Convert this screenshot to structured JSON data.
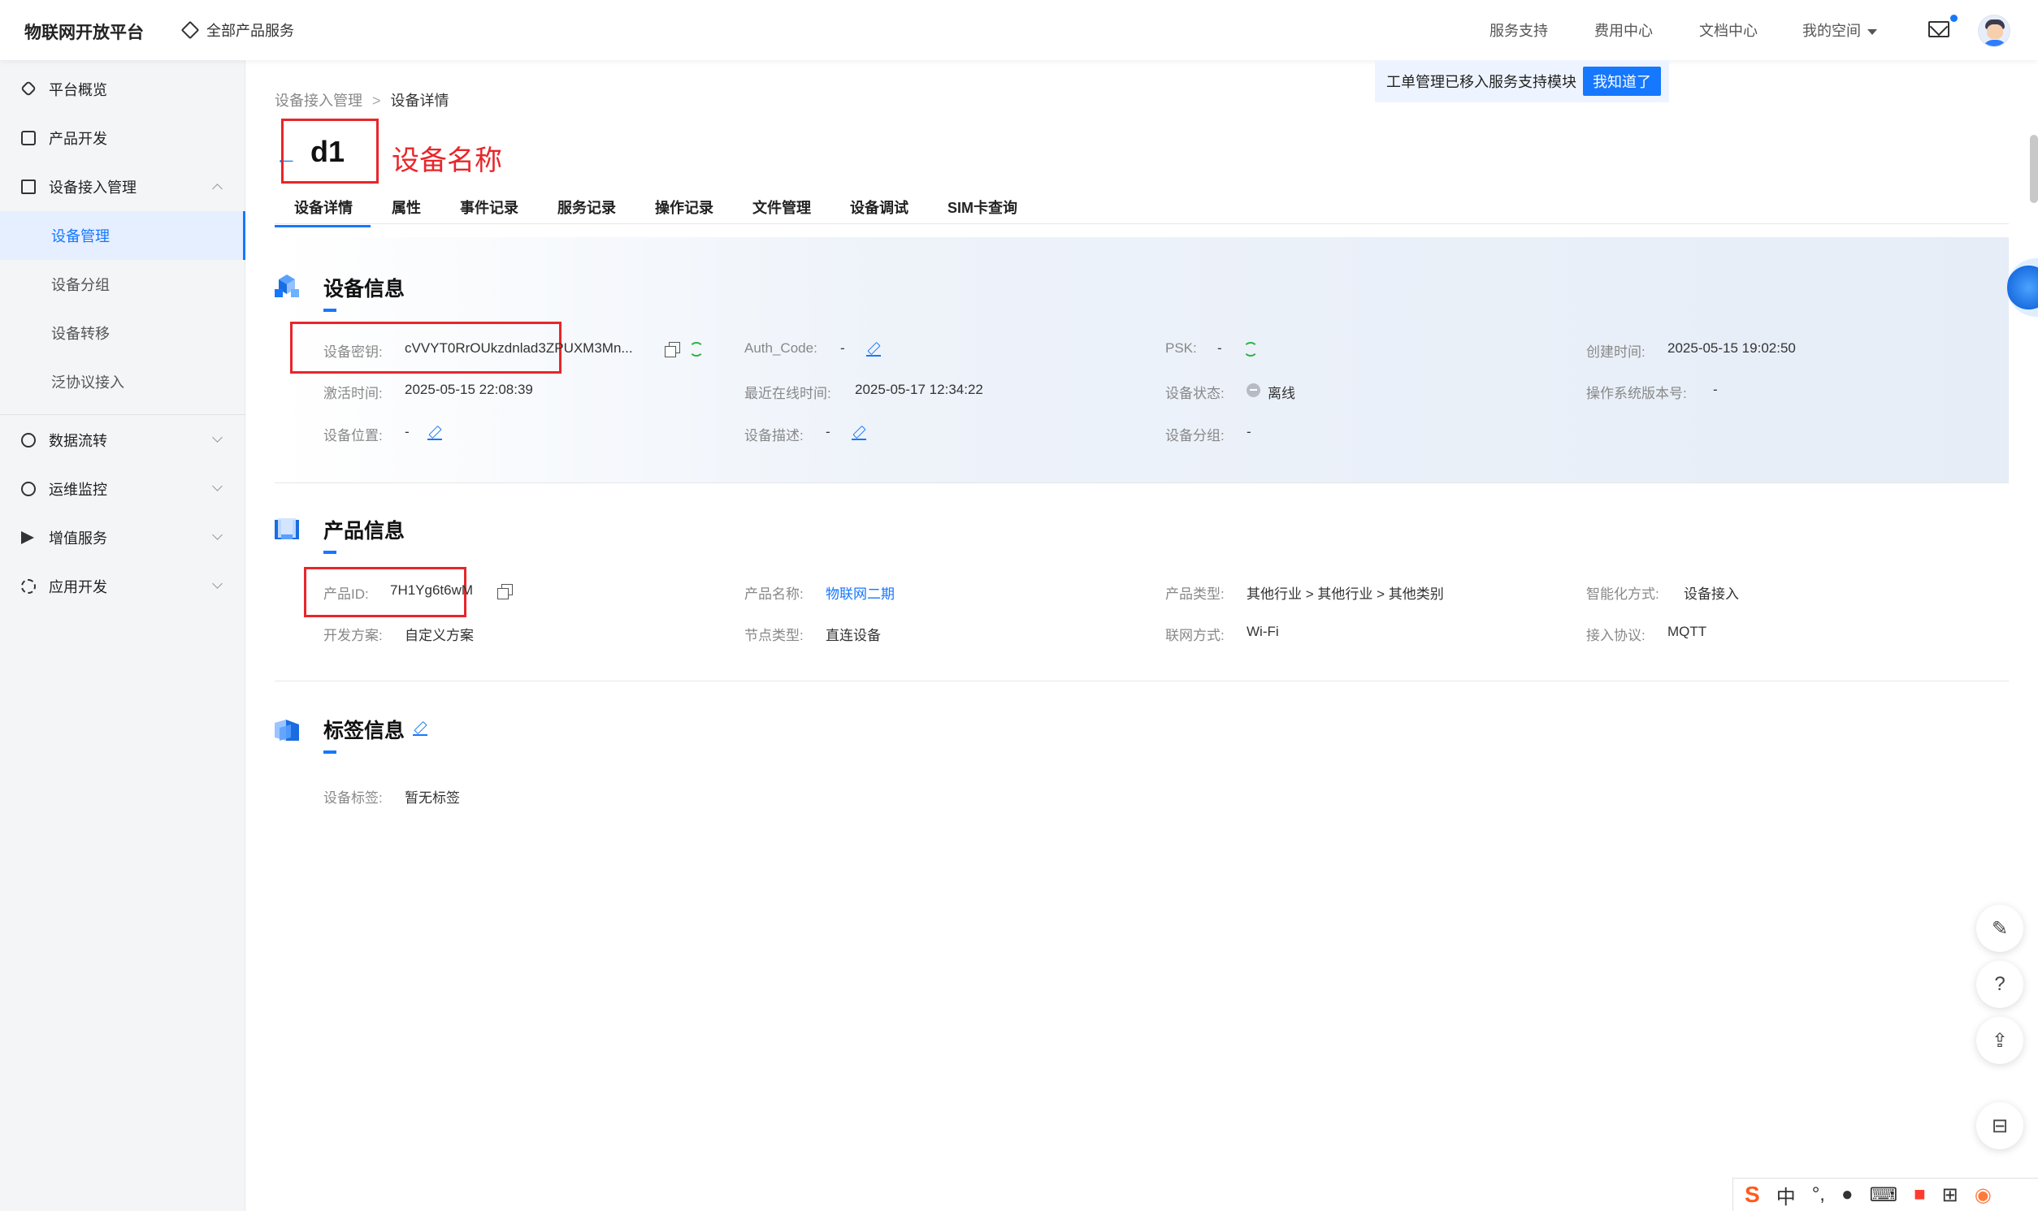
{
  "topbar": {
    "brand": "物联网开放平台",
    "all_products": "全部产品服务",
    "nav": [
      "服务支持",
      "费用中心",
      "文档中心",
      "我的空间"
    ]
  },
  "notice": {
    "text": "工单管理已移入服务支持模块",
    "button": "我知道了"
  },
  "sidebar": {
    "items": [
      {
        "label": "平台概览",
        "icon": "hexagon-icon"
      },
      {
        "label": "产品开发",
        "icon": "cube-icon"
      },
      {
        "label": "设备接入管理",
        "icon": "layers-icon",
        "expanded": true
      }
    ],
    "subitems": [
      "设备管理",
      "设备分组",
      "设备转移",
      "泛协议接入"
    ],
    "active_sub": "设备管理",
    "items2": [
      {
        "label": "数据流转",
        "icon": "flow-icon"
      },
      {
        "label": "运维监控",
        "icon": "monitor-icon"
      },
      {
        "label": "增值服务",
        "icon": "send-icon"
      },
      {
        "label": "应用开发",
        "icon": "dev-icon"
      }
    ]
  },
  "breadcrumb": {
    "parent": "设备接入管理",
    "separator": ">",
    "current": "设备详情"
  },
  "device": {
    "name": "d1",
    "annotation": "设备名称"
  },
  "tabs": [
    "设备详情",
    "属性",
    "事件记录",
    "服务记录",
    "操作记录",
    "文件管理",
    "设备调试",
    "SIM卡查询"
  ],
  "device_info": {
    "title": "设备信息",
    "fields": {
      "secret_label": "设备密钥:",
      "secret_value": "cVVYT0RrOUkzdnlad3ZPUXM3Mn...",
      "auth_label": "Auth_Code:",
      "auth_value": "-",
      "psk_label": "PSK:",
      "psk_value": "-",
      "created_label": "创建时间:",
      "created_value": "2025-05-15 19:02:50",
      "activated_label": "激活时间:",
      "activated_value": "2025-05-15 22:08:39",
      "last_online_label": "最近在线时间:",
      "last_online_value": "2025-05-17 12:34:22",
      "status_label": "设备状态:",
      "status_value": "离线",
      "os_label": "操作系统版本号:",
      "os_value": "-",
      "location_label": "设备位置:",
      "location_value": "-",
      "desc_label": "设备描述:",
      "desc_value": "-",
      "group_label": "设备分组:",
      "group_value": "-"
    }
  },
  "product_info": {
    "title": "产品信息",
    "fields": {
      "id_label": "产品ID:",
      "id_value": "7H1Yg6t6wM",
      "name_label": "产品名称:",
      "name_value": "物联网二期",
      "type_label": "产品类型:",
      "type_value": "其他行业 > 其他行业 > 其他类别",
      "smart_label": "智能化方式:",
      "smart_value": "设备接入",
      "scheme_label": "开发方案:",
      "scheme_value": "自定义方案",
      "node_label": "节点类型:",
      "node_value": "直连设备",
      "network_label": "联网方式:",
      "network_value": "Wi-Fi",
      "protocol_label": "接入协议:",
      "protocol_value": "MQTT"
    }
  },
  "tag_info": {
    "title": "标签信息",
    "tag_label": "设备标签:",
    "tag_value": "暂无标签"
  },
  "ime": {
    "lang": "中",
    "punct": "°,"
  },
  "colors": {
    "accent": "#1677ff",
    "annotation_red": "#e8262a",
    "online_green": "#2fb344"
  }
}
